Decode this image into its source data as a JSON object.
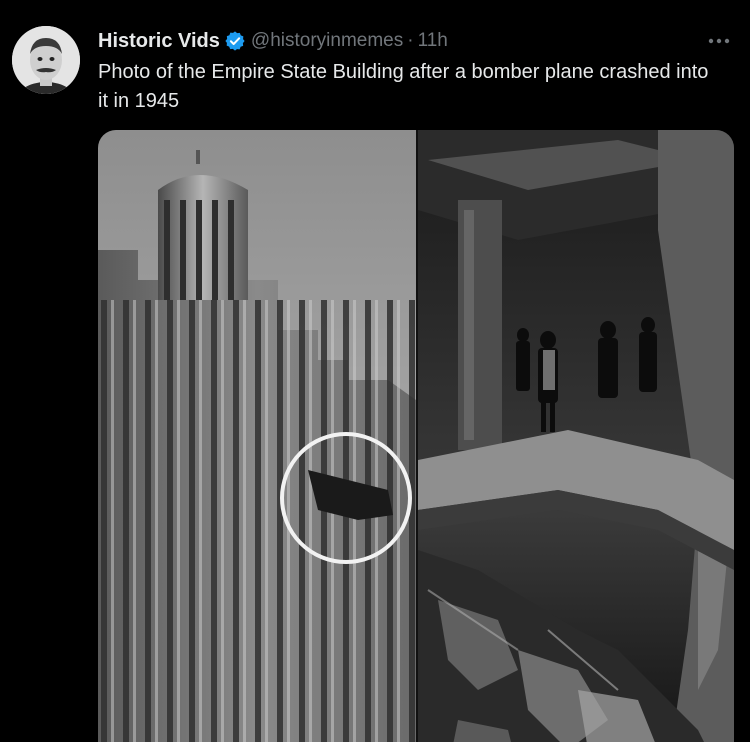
{
  "tweet": {
    "display_name": "Historic Vids",
    "verified_icon": "verified-badge-icon",
    "handle": "@historyinmemes",
    "separator": "·",
    "time": "11h",
    "more_icon": "more-dots-icon",
    "text": "Photo of the Empire State Building after a bomber plane crashed into it in 1945"
  },
  "colors": {
    "background": "#000000",
    "text_primary": "#e7e9ea",
    "text_secondary": "#71767b",
    "verified_blue": "#1d9bf0"
  },
  "media": {
    "left_panel": "empire-state-building-exterior-photo",
    "right_panel": "crash-damage-interior-photo"
  }
}
